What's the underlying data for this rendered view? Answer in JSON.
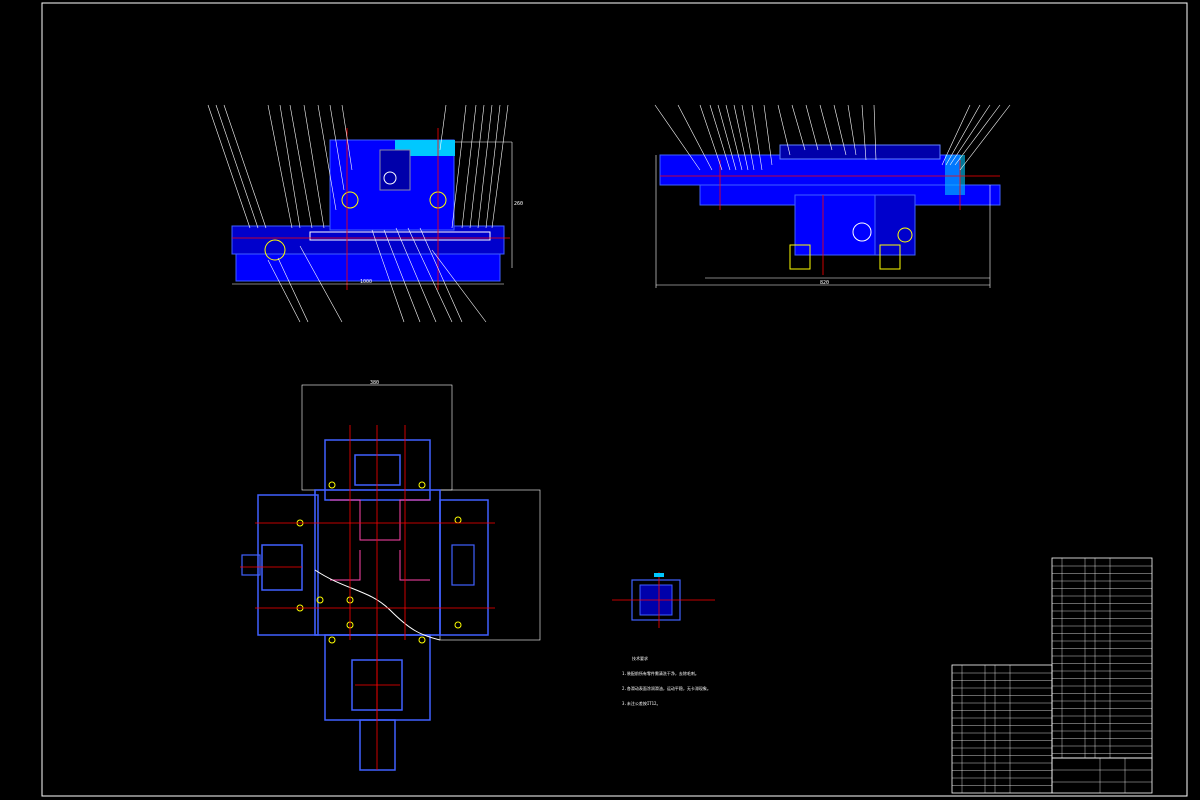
{
  "drawing": {
    "background": "#000000",
    "colors": {
      "frame": "#ffffff",
      "part": "#0000ff",
      "centerline": "#ff0000",
      "dimension": "#ffffff",
      "section": "#00c8ff",
      "hidden": "#ff00ff"
    },
    "views": [
      {
        "name": "front-view"
      },
      {
        "name": "side-view"
      },
      {
        "name": "top-view"
      },
      {
        "name": "detail-view"
      }
    ],
    "notes": {
      "heading": "技术要求",
      "lines": [
        "1.装配前所有零件需清洗干净，去除毛刺。",
        "2.各滑动表面涂润滑油，运动平稳，无卡滞现象。",
        "3.未注公差按IT12。"
      ]
    },
    "dimensions": {
      "front_width": "1000",
      "front_height": "260",
      "side_width": "820",
      "top_width": "380"
    }
  }
}
